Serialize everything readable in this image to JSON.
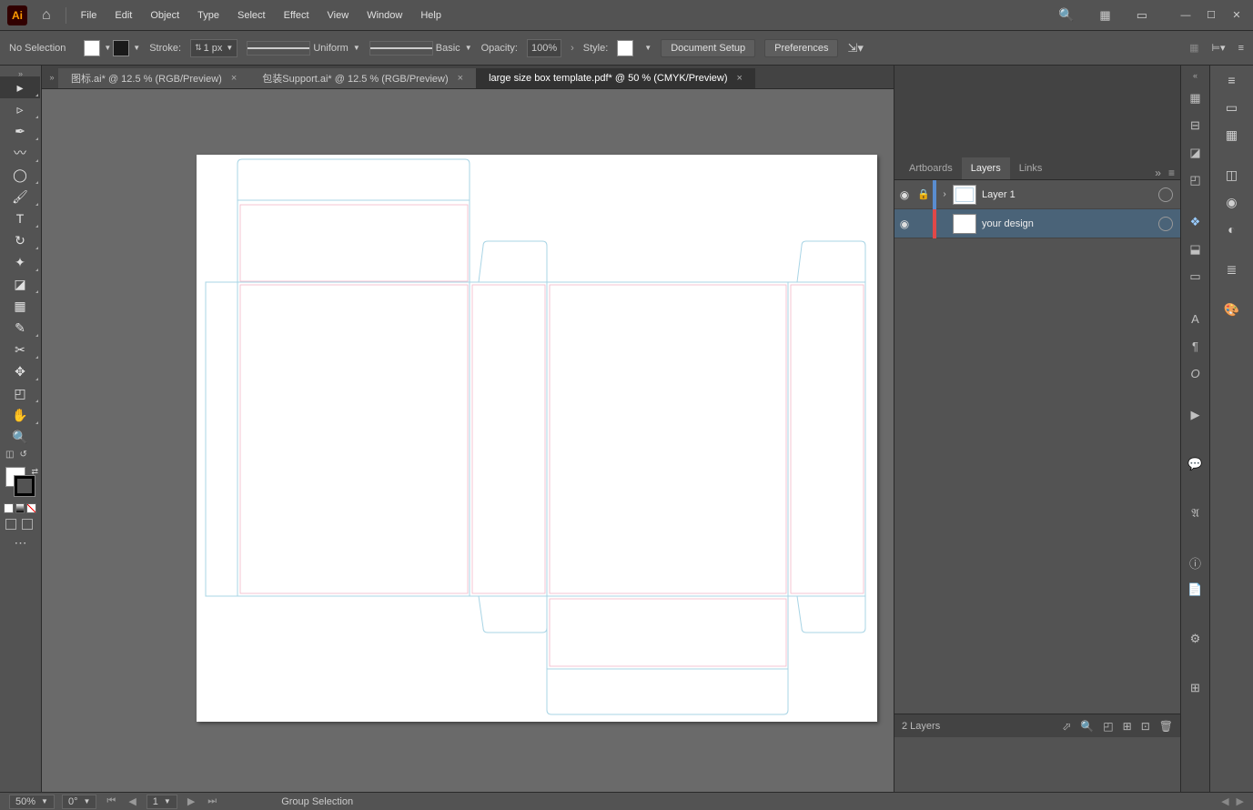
{
  "menubar": {
    "items": [
      "File",
      "Edit",
      "Object",
      "Type",
      "Select",
      "Effect",
      "View",
      "Window",
      "Help"
    ]
  },
  "controlbar": {
    "selection": "No Selection",
    "stroke_label": "Stroke:",
    "stroke_value": "1 px",
    "brush_label": "Uniform",
    "style_basic": "Basic",
    "opacity_label": "Opacity:",
    "opacity_value": "100%",
    "style_label": "Style:",
    "doc_setup": "Document Setup",
    "prefs": "Preferences"
  },
  "tabs": [
    {
      "title": "图标.ai* @ 12.5 % (RGB/Preview)",
      "active": false
    },
    {
      "title": "包装Support.ai* @ 12.5 % (RGB/Preview)",
      "active": false
    },
    {
      "title": "large size box template.pdf* @ 50 % (CMYK/Preview)",
      "active": true
    }
  ],
  "panel": {
    "tabs": [
      "Artboards",
      "Layers",
      "Links"
    ],
    "active_tab": "Layers",
    "layers": [
      {
        "name": "Layer 1",
        "color": "blue",
        "locked": true,
        "expanded": false
      },
      {
        "name": "your design",
        "color": "red",
        "locked": false,
        "selected": true
      }
    ],
    "footer": "2 Layers"
  },
  "status": {
    "zoom": "50%",
    "rotate": "0°",
    "page": "1",
    "tool": "Group Selection"
  }
}
